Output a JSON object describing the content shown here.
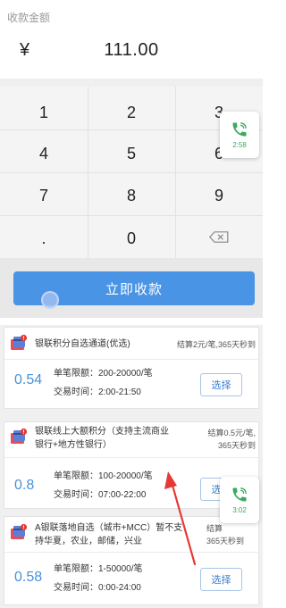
{
  "payment": {
    "amount_label": "收款金额",
    "currency_symbol": "¥",
    "amount": "111.00",
    "keypad": [
      "1",
      "2",
      "3",
      "4",
      "5",
      "6",
      "7",
      "8",
      "9",
      ".",
      "0"
    ],
    "pay_button_label": "立即收款"
  },
  "floating_call_top": {
    "time": "2:58"
  },
  "floating_call_bottom": {
    "time": "3:02"
  },
  "channels": [
    {
      "title_lines": [
        "银联积分自选通道(优选)"
      ],
      "fee_lines": [
        "结算2元/笔,365天秒到"
      ],
      "rate": "0.54",
      "limit": "单笔限额：200-20000/笔",
      "hours": "交易时间：2:00-21:50",
      "button": "选择"
    },
    {
      "title_lines": [
        "银联线上大额积分（支持主流商业",
        "银行+地方性银行）"
      ],
      "fee_lines": [
        "结算0.5元/笔,",
        "365天秒到"
      ],
      "rate": "0.8",
      "limit": "单笔限额：100-20000/笔",
      "hours": "交易时间：07:00-22:00",
      "button": "选择"
    },
    {
      "title_lines": [
        "A银联落地自选（城市+MCC）暂不支",
        "持华夏，农业，邮储，兴业"
      ],
      "fee_lines": [
        "结算",
        "365天秒到"
      ],
      "rate": "0.58",
      "limit": "单笔限额：1-50000/笔",
      "hours": "交易时间：0:00-24:00",
      "button": "选择"
    }
  ],
  "colors": {
    "accent": "#4a94e6",
    "rate_blue": "#4a90d9",
    "call_green": "#3aaa5c",
    "arrow_red": "#e53935"
  },
  "icons": [
    "card-icon",
    "phone-icon",
    "backspace-icon",
    "arrow-icon"
  ]
}
